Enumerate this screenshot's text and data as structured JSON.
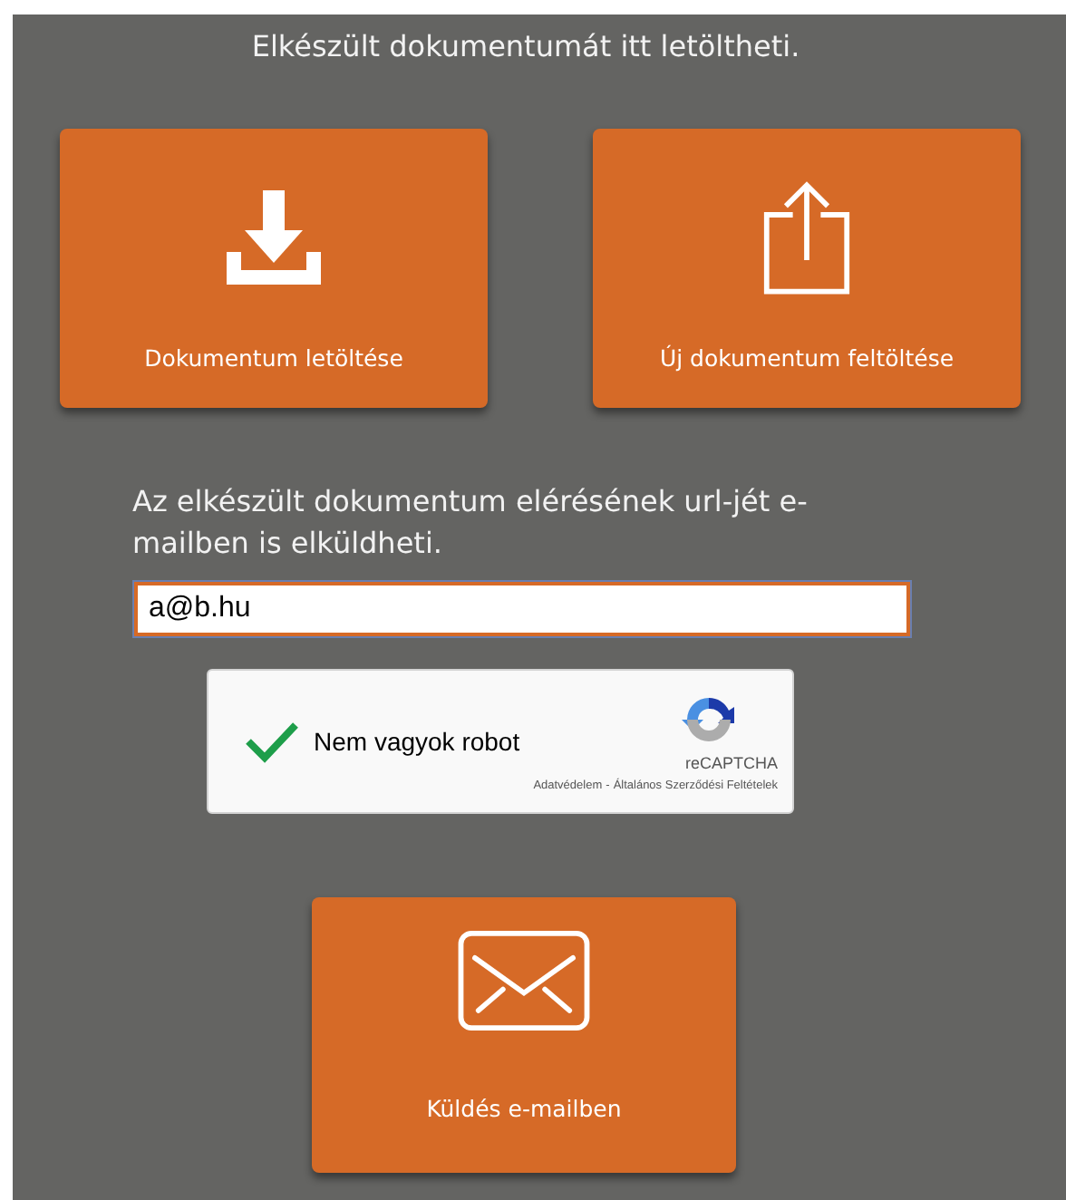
{
  "heading": "Elkészült dokumentumát itt letöltheti.",
  "actions": [
    {
      "kind": "download",
      "label": "Dokumentum letöltése"
    },
    {
      "kind": "upload",
      "label": "Új dokumentum feltöltése"
    }
  ],
  "email_prompt": "Az elkészült dokumentum elérésének url-jét e-mailben is elküldheti.",
  "email_field": {
    "value": "a@b.hu"
  },
  "captcha": {
    "checked": true,
    "label": "Nem vagyok robot",
    "brand": "reCAPTCHA",
    "links": [
      "Adatvédelem",
      "-",
      "Általános Szerződési Feltételek"
    ]
  },
  "send_button": {
    "kind": "mail",
    "label": "Küldés e-mailben"
  }
}
